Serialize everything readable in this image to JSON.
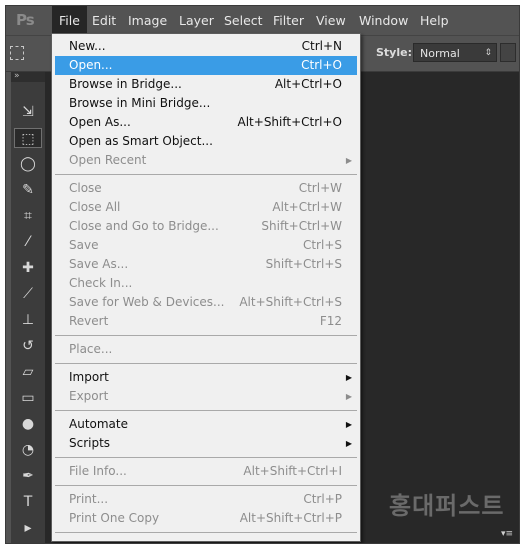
{
  "app": {
    "logo": "Ps"
  },
  "menubar": {
    "items": [
      {
        "label": "File",
        "active": true
      },
      {
        "label": "Edit"
      },
      {
        "label": "Image"
      },
      {
        "label": "Layer"
      },
      {
        "label": "Select"
      },
      {
        "label": "Filter"
      },
      {
        "label": "View"
      },
      {
        "label": "Window"
      },
      {
        "label": "Help"
      }
    ]
  },
  "options_bar": {
    "style_label": "Style:",
    "style_value": "Normal"
  },
  "file_menu": [
    {
      "label": "New...",
      "shortcut": "Ctrl+N"
    },
    {
      "label": "Open...",
      "shortcut": "Ctrl+O",
      "highlighted": true
    },
    {
      "label": "Browse in Bridge...",
      "shortcut": "Alt+Ctrl+O"
    },
    {
      "label": "Browse in Mini Bridge..."
    },
    {
      "label": "Open As...",
      "shortcut": "Alt+Shift+Ctrl+O"
    },
    {
      "label": "Open as Smart Object..."
    },
    {
      "label": "Open Recent",
      "disabled": true,
      "submenu": true
    },
    {
      "separator": true
    },
    {
      "label": "Close",
      "shortcut": "Ctrl+W",
      "disabled": true
    },
    {
      "label": "Close All",
      "shortcut": "Alt+Ctrl+W",
      "disabled": true
    },
    {
      "label": "Close and Go to Bridge...",
      "shortcut": "Shift+Ctrl+W",
      "disabled": true
    },
    {
      "label": "Save",
      "shortcut": "Ctrl+S",
      "disabled": true
    },
    {
      "label": "Save As...",
      "shortcut": "Shift+Ctrl+S",
      "disabled": true
    },
    {
      "label": "Check In...",
      "disabled": true
    },
    {
      "label": "Save for Web & Devices...",
      "shortcut": "Alt+Shift+Ctrl+S",
      "disabled": true
    },
    {
      "label": "Revert",
      "shortcut": "F12",
      "disabled": true
    },
    {
      "separator": true
    },
    {
      "label": "Place...",
      "disabled": true
    },
    {
      "separator": true
    },
    {
      "label": "Import",
      "submenu": true
    },
    {
      "label": "Export",
      "disabled": true,
      "submenu": true
    },
    {
      "separator": true
    },
    {
      "label": "Automate",
      "submenu": true
    },
    {
      "label": "Scripts",
      "submenu": true
    },
    {
      "separator": true
    },
    {
      "label": "File Info...",
      "shortcut": "Alt+Shift+Ctrl+I",
      "disabled": true
    },
    {
      "separator": true
    },
    {
      "label": "Print...",
      "shortcut": "Ctrl+P",
      "disabled": true
    },
    {
      "label": "Print One Copy",
      "shortcut": "Alt+Shift+Ctrl+P",
      "disabled": true
    },
    {
      "separator": true
    }
  ],
  "toolbar": {
    "tools": [
      {
        "name": "move-tool-icon",
        "glyph": "⇲"
      },
      {
        "name": "marquee-tool-icon",
        "glyph": "⬚",
        "selected": true
      },
      {
        "name": "lasso-tool-icon",
        "glyph": "◯"
      },
      {
        "name": "quick-selection-tool-icon",
        "glyph": "✎"
      },
      {
        "name": "crop-tool-icon",
        "glyph": "⌗"
      },
      {
        "name": "eyedropper-tool-icon",
        "glyph": "⁄"
      },
      {
        "name": "healing-brush-tool-icon",
        "glyph": "✚"
      },
      {
        "name": "brush-tool-icon",
        "glyph": "⟋"
      },
      {
        "name": "clone-stamp-tool-icon",
        "glyph": "⊥"
      },
      {
        "name": "history-brush-tool-icon",
        "glyph": "↺"
      },
      {
        "name": "eraser-tool-icon",
        "glyph": "▱"
      },
      {
        "name": "gradient-tool-icon",
        "glyph": "▭"
      },
      {
        "name": "blur-tool-icon",
        "glyph": "●"
      },
      {
        "name": "dodge-tool-icon",
        "glyph": "◔"
      },
      {
        "name": "pen-tool-icon",
        "glyph": "✒"
      },
      {
        "name": "type-tool-icon",
        "glyph": "T"
      },
      {
        "name": "path-selection-tool-icon",
        "glyph": "▸"
      }
    ]
  },
  "watermark": {
    "text": "홍대퍼스트"
  }
}
